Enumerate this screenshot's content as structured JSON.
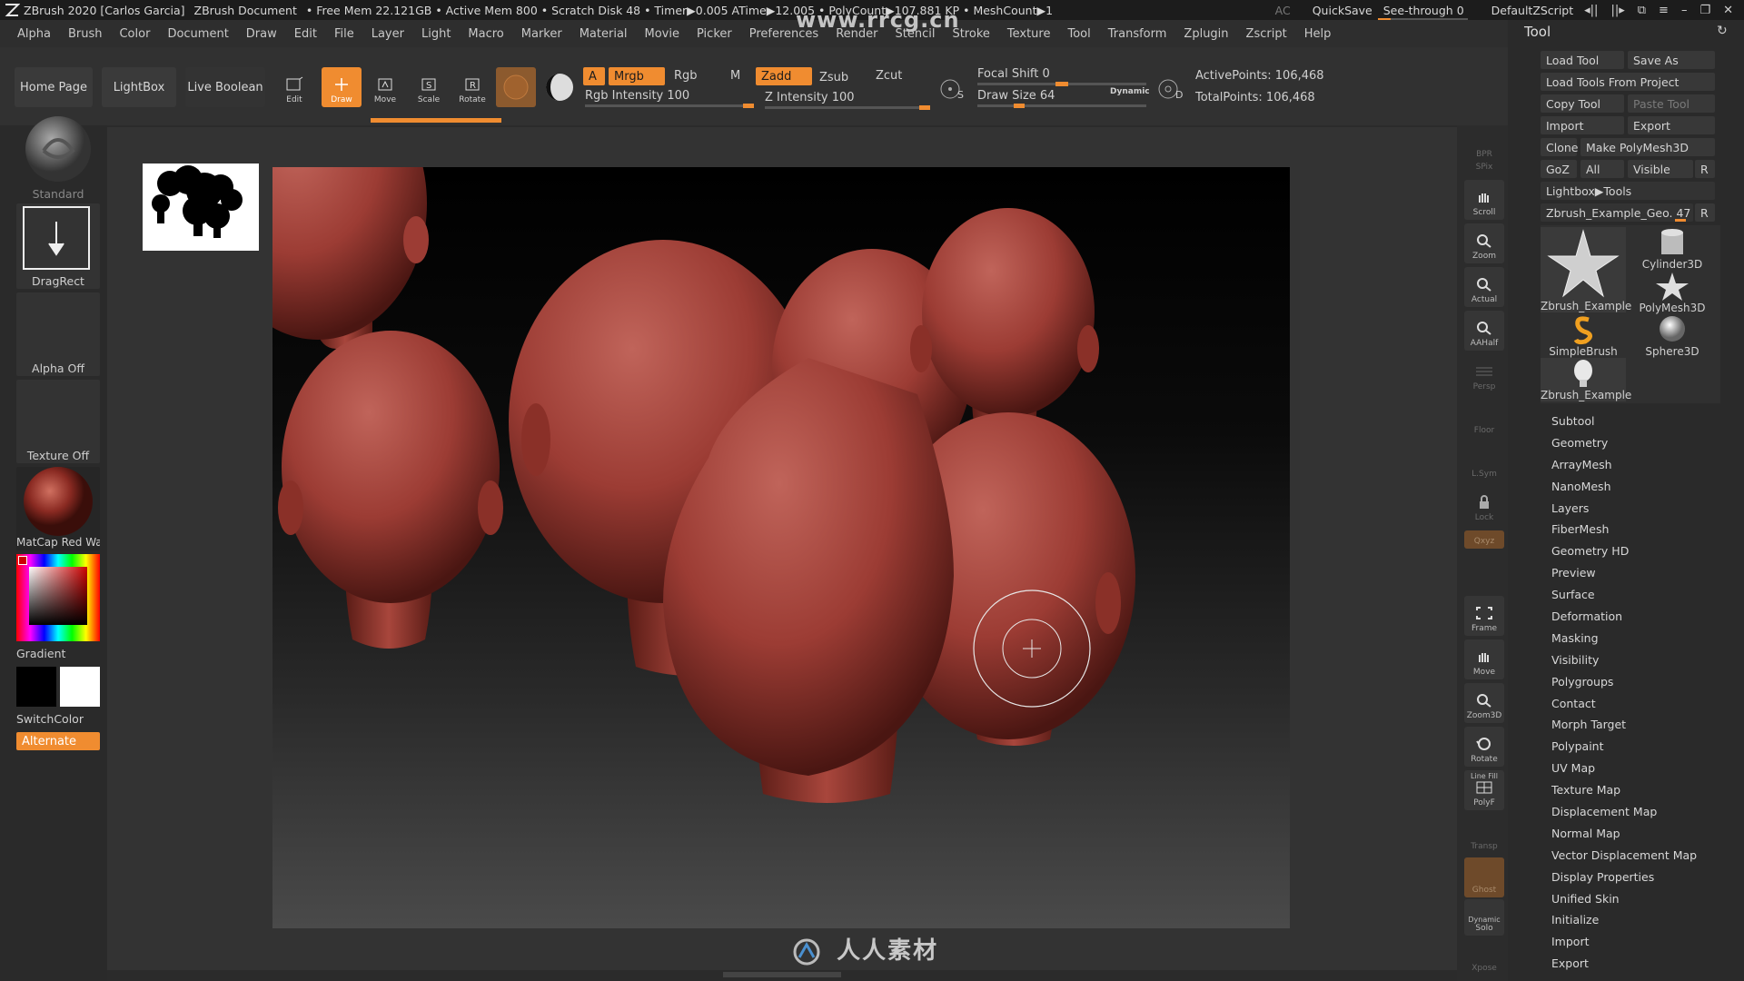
{
  "titlebar": {
    "app": "ZBrush 2020 [Carlos Garcia]",
    "document": "ZBrush Document",
    "stats": "• Free Mem 22.121GB • Active Mem 800 • Scratch Disk 48 • Timer▶0.005 ATime▶12.005 • PolyCount▶107.881 KP • MeshCount▶1",
    "ac": "AC",
    "quicksave": "QuickSave",
    "seethrough": "See-through",
    "seethrough_value": "0",
    "script": "DefaultZScript"
  },
  "menus": [
    "Alpha",
    "Brush",
    "Color",
    "Document",
    "Draw",
    "Edit",
    "File",
    "Layer",
    "Light",
    "Macro",
    "Marker",
    "Material",
    "Movie",
    "Picker",
    "Preferences",
    "Render",
    "Stencil",
    "Stroke",
    "Texture",
    "Tool",
    "Transform",
    "Zplugin",
    "Zscript",
    "Help"
  ],
  "shelf": {
    "home_page": "Home Page",
    "lightbox": "LightBox",
    "live_boolean": "Live Boolean",
    "edit": "Edit",
    "draw": "Draw",
    "move": "Move",
    "scale": "Scale",
    "rotate": "Rotate",
    "a": "A",
    "mrgb": "Mrgb",
    "rgb": "Rgb",
    "m": "M",
    "zadd": "Zadd",
    "zsub": "Zsub",
    "zcut": "Zcut",
    "rgb_intensity": "Rgb Intensity 100",
    "z_intensity": "Z Intensity 100",
    "focal_shift": "Focal Shift 0",
    "draw_size": "Draw Size 64",
    "dynamic": "Dynamic",
    "active_points": "ActivePoints: 106,468",
    "total_points": "TotalPoints: 106,468",
    "s": "S",
    "d": "D"
  },
  "left": {
    "brush": "Standard",
    "stroke": "DragRect",
    "alpha": "Alpha Off",
    "texture": "Texture Off",
    "material": "MatCap Red Wax",
    "gradient": "Gradient",
    "switchcolor": "SwitchColor",
    "alternate": "Alternate"
  },
  "rightshelf": [
    "BPR",
    "SPix",
    "Scroll",
    "Zoom",
    "Actual",
    "AAHalf",
    "Persp",
    "Floor",
    "L.Sym",
    "Lock",
    "Qxyz",
    "Frame",
    "Move",
    "Zoom3D",
    "Rotate",
    "Line Fill",
    "PolyF",
    "Transp",
    "Ghost",
    "Dynamic",
    "Solo",
    "Xpose"
  ],
  "tool": {
    "title": "Tool",
    "load_tool": "Load Tool",
    "save_as": "Save As",
    "load_from_project": "Load Tools From Project",
    "copy_tool": "Copy Tool",
    "paste_tool": "Paste Tool",
    "import": "Import",
    "export": "Export",
    "clone": "Clone",
    "make_polymesh": "Make PolyMesh3D",
    "goz": "GoZ",
    "all": "All",
    "visible": "Visible",
    "r": "R",
    "lightbox_tools": "Lightbox▶Tools",
    "current_tool": "Zbrush_Example_Geo. 47",
    "thumbs": [
      "Zbrush_Example",
      "Cylinder3D",
      "PolyMesh3D",
      "SimpleBrush",
      "Sphere3D",
      "Zbrush_Example"
    ],
    "subpalettes": [
      "Subtool",
      "Geometry",
      "ArrayMesh",
      "NanoMesh",
      "Layers",
      "FiberMesh",
      "Geometry HD",
      "Preview",
      "Surface",
      "Deformation",
      "Masking",
      "Visibility",
      "Polygroups",
      "Contact",
      "Morph Target",
      "Polypaint",
      "UV Map",
      "Texture Map",
      "Displacement Map",
      "Normal Map",
      "Vector Displacement Map",
      "Display Properties",
      "Unified Skin",
      "Initialize",
      "Import",
      "Export"
    ]
  },
  "colors": {
    "accent": "#f08c30",
    "wax": "#a8423a"
  },
  "watermark": "人人素材",
  "watermark_top": "www.rrcg.cn"
}
